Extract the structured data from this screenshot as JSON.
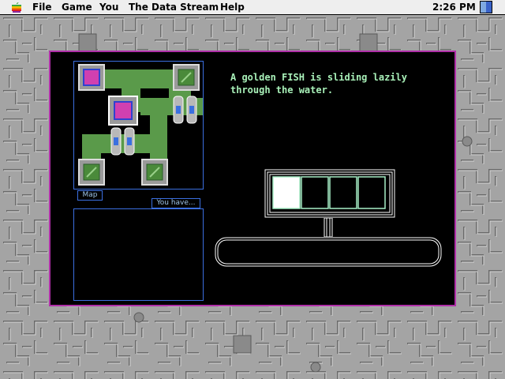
{
  "menubar": {
    "items": [
      "File",
      "Game",
      "You",
      "The Data Stream",
      "Help"
    ],
    "clock": "2:26 PM",
    "apple_icon": "apple-icon",
    "app_icon": "finder-icon"
  },
  "game": {
    "message": "A golden FISH is sliding lazily through the water.",
    "map_label": "Map",
    "inventory_label": "You have...",
    "slots": {
      "count": 4,
      "filled": 1
    },
    "colors": {
      "window_border": "#b02fa8",
      "panel_border": "#3b6fe0",
      "text": "#a8f0b8",
      "corridor": "#5a9a4a",
      "desktop": "#a8a8a8"
    }
  }
}
